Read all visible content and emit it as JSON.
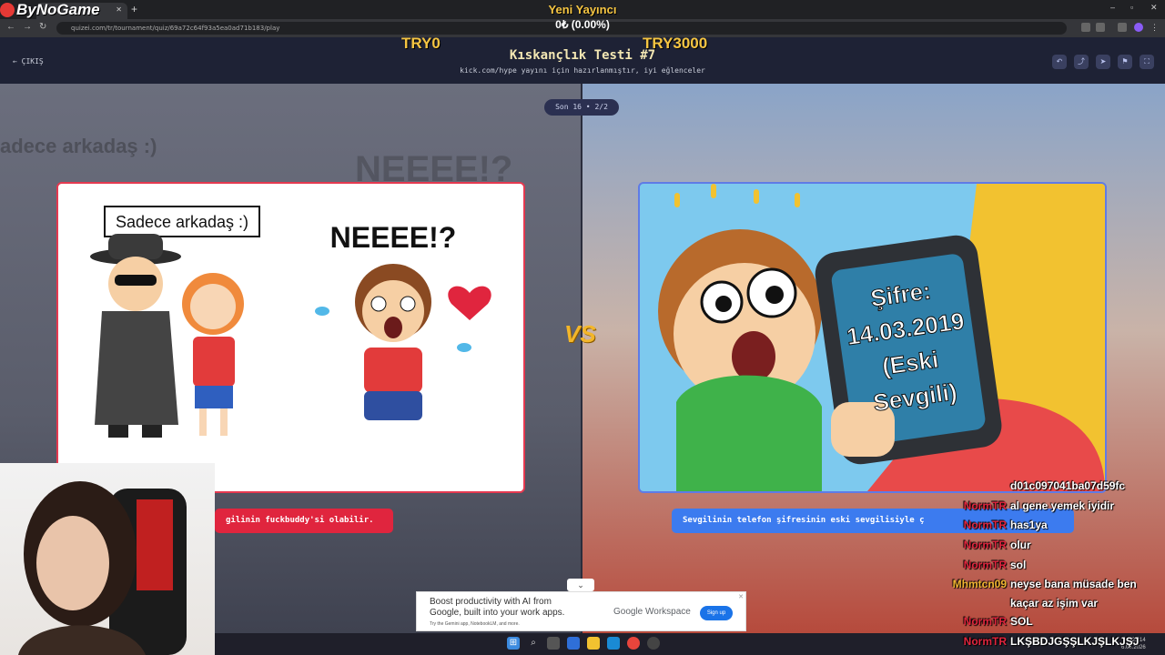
{
  "browser": {
    "tab_title": "ByNoGame",
    "url": "quizei.com/tr/tournament/quiz/69a72c64f93a5ea0ad71b183/play"
  },
  "overlay": {
    "brand": "ByNoGame",
    "new_streamer_label": "Yeni Yayıncı",
    "new_streamer_value": "0₺ (0.00%)",
    "left_amount": "TRY0",
    "right_amount": "TRY3000"
  },
  "header": {
    "exit_label": "ÇIKIŞ",
    "title": "Kıskançlık Testi #7",
    "subtitle": "kick.com/hype yayını için hazırlanmıştır, iyi eğlenceler",
    "action_icons": [
      "undo-icon",
      "share-icon",
      "send-icon",
      "flag-icon",
      "fullscreen-icon"
    ]
  },
  "round_badge": "Son 16 • 2/2",
  "background_texts": {
    "left": "adece arkadaş :)",
    "center": "NEEEE!?"
  },
  "left_option": {
    "image_label": "Sadece arkadaş :)",
    "image_shout": "NEEEE!?",
    "caption": "gilinin fuckbuddy'si olabilir."
  },
  "right_option": {
    "phone_text_1": "Şifre:",
    "phone_text_2": "14.03.2019",
    "phone_text_3": "(Eski",
    "phone_text_4": "Sevgili)",
    "caption": "Sevgilinin telefon şifresinin eski sevgilisiyle ç"
  },
  "vs_label": "VS",
  "scroll_icon": "chevron-down-icon",
  "ad": {
    "headline": "Boost productivity with AI from Google, built into your work apps.",
    "sub": "Try the Gemini app, NotebookLM, and more.",
    "brand": "Google Workspace",
    "cta": "Sign up"
  },
  "chat": [
    {
      "user": "",
      "text": "d01c097041ba07d59fc",
      "color": "#ffffff"
    },
    {
      "user": "NormTR",
      "text": "al gene yemek iyidir",
      "color": "#e0253e"
    },
    {
      "user": "NormTR",
      "text": "has1ya",
      "color": "#e0253e"
    },
    {
      "user": "NormTR",
      "text": "olur",
      "color": "#e0253e"
    },
    {
      "user": "NormTR",
      "text": "sol",
      "color": "#e0253e"
    },
    {
      "user": "Mhmtcn09",
      "text": "neyse bana müsade ben kaçar az işim var",
      "color": "#f2b632"
    },
    {
      "user": "NormTR",
      "text": "SOL",
      "color": "#e0253e"
    },
    {
      "user": "NormTR",
      "text": "LKŞBDJGŞŞLKJŞLKJŞJ",
      "color": "#e0253e"
    }
  ],
  "taskbar": {
    "time": "23:14",
    "date": "6.03.2026"
  }
}
